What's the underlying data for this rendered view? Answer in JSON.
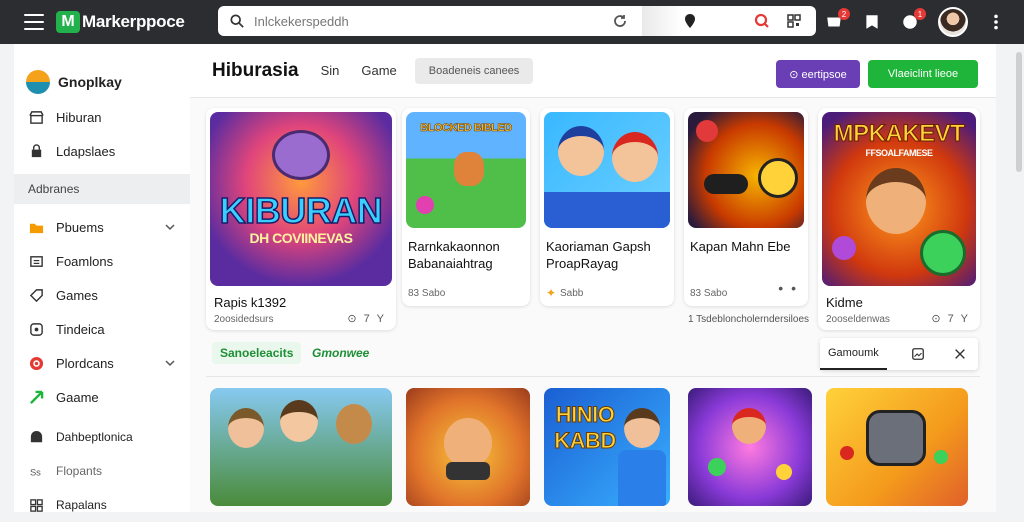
{
  "topbar": {
    "brand_letter": "M",
    "brand_name": "Markerppoce",
    "search_placeholder": "Inlckekerspeddh",
    "notifications_badge": "2",
    "messages_badge": "1"
  },
  "sidebar": {
    "profile_name": "Gnoplkay",
    "items_top": [
      {
        "label": "Hiburan",
        "icon": "store-icon"
      },
      {
        "label": "Ldapslaes",
        "icon": "bag-icon"
      }
    ],
    "section_label": "Adbranes",
    "items_mid": [
      {
        "label": "Pbuems",
        "icon": "folder-icon",
        "expand": true
      },
      {
        "label": "Foamlons",
        "icon": "list-icon",
        "expand": false
      },
      {
        "label": "Games",
        "icon": "tag-icon",
        "expand": false
      },
      {
        "label": "Tindeica",
        "icon": "clock-icon",
        "expand": false
      },
      {
        "label": "Plordcans",
        "icon": "target-icon",
        "expand": true
      },
      {
        "label": "Gaame",
        "icon": "arrow-icon",
        "expand": false
      }
    ],
    "items_bottom": [
      {
        "label": "Dahbeptlonica",
        "icon": "shop-icon"
      },
      {
        "label": "Flopants",
        "icon": "text-icon"
      },
      {
        "label": "Rapalans",
        "icon": "grid-icon"
      }
    ]
  },
  "header": {
    "title": "Hiburasia",
    "tabs": [
      "Sin",
      "Game"
    ],
    "pill": "Boadeneis canees",
    "purple_button": "⊙ eertipsoe",
    "green_button": "Vlaeiclint lieoe"
  },
  "row1": [
    {
      "thumb_text": "KIBURAN",
      "thumb_sub": "DH COVIINEVAS",
      "title": "Rapis k1392",
      "meta": "2oosidedsurs",
      "actions": "⊙ 7 Y"
    },
    {
      "thumb_text": "BLOCKED BIBLED",
      "title": "Rarnkakaonnon Babanaiahtrag",
      "meta": "83 Sabo",
      "actions": ""
    },
    {
      "thumb_text": "",
      "title": "Kaoriaman Gapsh ProapRayag",
      "meta": "Sabb",
      "actions": ""
    },
    {
      "thumb_text": "",
      "title": "Kapan Mahn Ebe",
      "meta": "83 Sabo",
      "actions": "• •"
    },
    {
      "thumb_text": "MPKAKEVT",
      "thumb_sub": "FFSOALFAMESE",
      "title": "Kidme",
      "meta": "2ooseldenwas",
      "actions": "⊙ 7 Y"
    }
  ],
  "row1_caption": "1 Tsdebloncholerndersiloes",
  "chips": [
    "Sanoeleacits",
    "Gmonwee"
  ],
  "popup": {
    "label": "Gamoumk"
  },
  "row2": [
    {
      "thumb_text": ""
    },
    {
      "thumb_text": ""
    },
    {
      "thumb_text": "HINIO KABD"
    },
    {
      "thumb_text": ""
    },
    {
      "thumb_text": ""
    }
  ],
  "colors": {
    "topbar": "#2b2d31",
    "purple": "#6a3fb5",
    "green": "#1eb53a",
    "accent_red": "#e53935"
  }
}
